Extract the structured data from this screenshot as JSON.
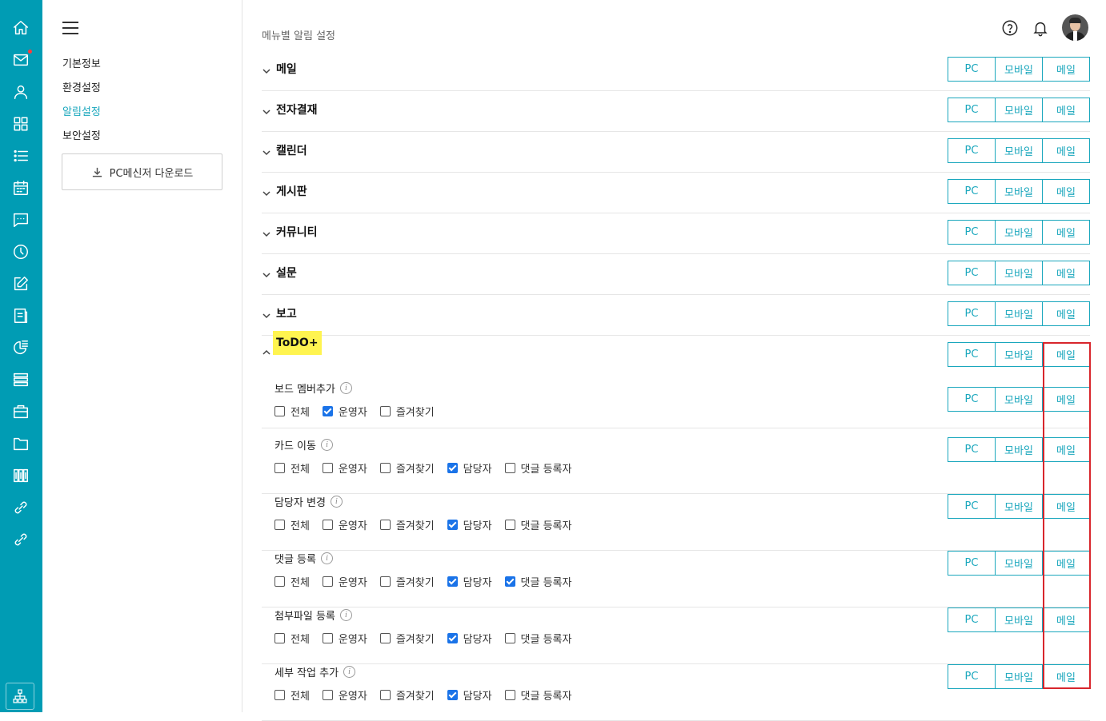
{
  "rail": {
    "icons": [
      "home-icon",
      "mail-icon",
      "user-icon",
      "apps-icon",
      "list-icon",
      "calendar-icon",
      "chat-icon",
      "clock-icon",
      "edit-icon",
      "report-icon",
      "chart-icon",
      "board-icon",
      "briefcase-icon",
      "folder-icon",
      "kanban-icon",
      "link-icon",
      "link-alt-icon"
    ],
    "notification_dot_color": "#ff3b3b",
    "bottom_icon": "org-chart-icon"
  },
  "sidebar": {
    "items": [
      {
        "label": "기본정보",
        "active": false
      },
      {
        "label": "환경설정",
        "active": false
      },
      {
        "label": "알림설정",
        "active": true
      },
      {
        "label": "보안설정",
        "active": false
      }
    ],
    "download_label": "PC메신저 다운로드"
  },
  "header": {
    "title": "메뉴별 알림 설정"
  },
  "buttons": {
    "pc": "PC",
    "mobile": "모바일",
    "mail": "메일"
  },
  "categories": [
    {
      "label": "메일",
      "expanded": false
    },
    {
      "label": "전자결재",
      "expanded": false
    },
    {
      "label": "캘린더",
      "expanded": false
    },
    {
      "label": "게시판",
      "expanded": false
    },
    {
      "label": "커뮤니티",
      "expanded": false
    },
    {
      "label": "설문",
      "expanded": false
    },
    {
      "label": "보고",
      "expanded": false
    },
    {
      "label": "ToDO+",
      "expanded": true,
      "highlighted": true
    }
  ],
  "todo_items": [
    {
      "title": "보드 멤버추가",
      "checks": [
        {
          "label": "전체",
          "checked": false
        },
        {
          "label": "운영자",
          "checked": true
        },
        {
          "label": "즐겨찾기",
          "checked": false
        }
      ]
    },
    {
      "title": "카드 이동",
      "checks": [
        {
          "label": "전체",
          "checked": false
        },
        {
          "label": "운영자",
          "checked": false
        },
        {
          "label": "즐겨찾기",
          "checked": false
        },
        {
          "label": "담당자",
          "checked": true
        },
        {
          "label": "댓글 등록자",
          "checked": false
        }
      ]
    },
    {
      "title": "담당자 변경",
      "checks": [
        {
          "label": "전체",
          "checked": false
        },
        {
          "label": "운영자",
          "checked": false
        },
        {
          "label": "즐겨찾기",
          "checked": false
        },
        {
          "label": "담당자",
          "checked": true
        },
        {
          "label": "댓글 등록자",
          "checked": false
        }
      ]
    },
    {
      "title": "댓글 등록",
      "checks": [
        {
          "label": "전체",
          "checked": false
        },
        {
          "label": "운영자",
          "checked": false
        },
        {
          "label": "즐겨찾기",
          "checked": false
        },
        {
          "label": "담당자",
          "checked": true
        },
        {
          "label": "댓글 등록자",
          "checked": true
        }
      ]
    },
    {
      "title": "첨부파일 등록",
      "checks": [
        {
          "label": "전체",
          "checked": false
        },
        {
          "label": "운영자",
          "checked": false
        },
        {
          "label": "즐겨찾기",
          "checked": false
        },
        {
          "label": "담당자",
          "checked": true
        },
        {
          "label": "댓글 등록자",
          "checked": false
        }
      ]
    },
    {
      "title": "세부 작업 추가",
      "checks": [
        {
          "label": "전체",
          "checked": false
        },
        {
          "label": "운영자",
          "checked": false
        },
        {
          "label": "즐겨찾기",
          "checked": false
        },
        {
          "label": "담당자",
          "checked": true
        },
        {
          "label": "댓글 등록자",
          "checked": false
        }
      ]
    }
  ],
  "colors": {
    "rail": "#009cb4",
    "accent": "#1aa7bd",
    "highlight": "#fff450",
    "annotation": "#d8262c",
    "checkbox": "#1a73e8"
  }
}
